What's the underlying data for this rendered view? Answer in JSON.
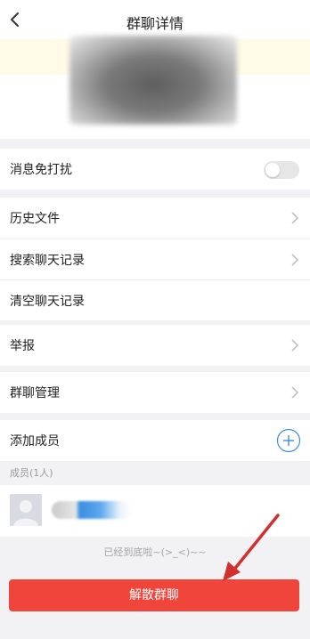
{
  "header": {
    "title": "群聊详情"
  },
  "settings": {
    "mute_label": "消息免打扰",
    "mute_enabled": false,
    "history_files_label": "历史文件",
    "search_chat_label": "搜索聊天记录",
    "clear_chat_label": "清空聊天记录",
    "report_label": "举报",
    "manage_label": "群聊管理",
    "add_member_label": "添加成员"
  },
  "members": {
    "header": "成员(1人)"
  },
  "footer": {
    "end_text": "已经到底啦~(>_<)~~",
    "dissolve_label": "解散群聊"
  },
  "colors": {
    "accent_red": "#f0453a",
    "add_icon_blue": "#3b8fe0",
    "annotation_arrow": "#d32f2f"
  }
}
